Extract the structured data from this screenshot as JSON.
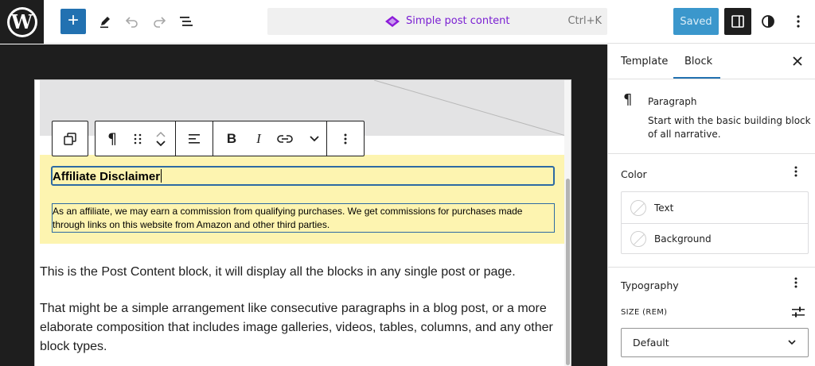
{
  "toolbar": {
    "document_title": "Simple post content",
    "shortcut": "Ctrl+K",
    "saved_label": "Saved"
  },
  "editor": {
    "heading": "Affiliate Disclaimer",
    "disclaimer_text": "As an affiliate, we may earn a commission from qualifying purchases. We get commissions for purchases made through links on this website from Amazon and other third parties.",
    "paragraph_1": "This is the Post Content block, it will display all the blocks in any single post or page.",
    "paragraph_2": "That might be a simple arrangement like consecutive paragraphs in a blog post, or a more elaborate composition that includes image galleries, videos, tables, columns, and any other block types."
  },
  "sidebar": {
    "tabs": [
      {
        "label": "Template"
      },
      {
        "label": "Block",
        "active": true
      }
    ],
    "block_card": {
      "icon": "¶",
      "name": "Paragraph",
      "description": "Start with the basic building block of all narrative."
    },
    "color_panel": {
      "title": "Color",
      "items": [
        {
          "label": "Text"
        },
        {
          "label": "Background"
        }
      ]
    },
    "typography_panel": {
      "title": "Typography",
      "size_label": "SIZE (REM)",
      "size_value": "Default"
    }
  },
  "colors": {
    "accent": "#2271b1",
    "command_purple": "#8c1bd9",
    "group_background": "#fdf4b0",
    "canvas_dark": "#1e1e1e"
  }
}
